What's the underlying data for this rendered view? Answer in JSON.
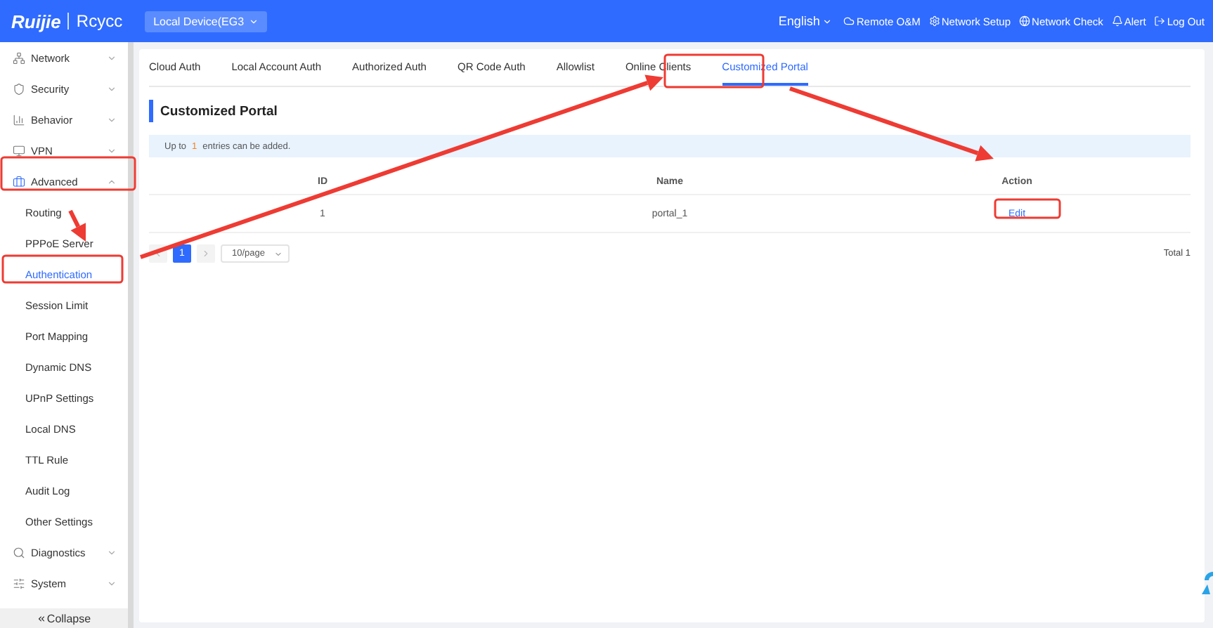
{
  "header": {
    "brand": "Ruijie",
    "product": "Rcycc",
    "device": "Local Device(EG3",
    "language": "English",
    "links": [
      {
        "kind": "cloud",
        "label": "Remote O&M"
      },
      {
        "kind": "setup",
        "label": "Network Setup"
      },
      {
        "kind": "check",
        "label": "Network Check"
      },
      {
        "kind": "alert",
        "label": "Alert"
      },
      {
        "kind": "logout",
        "label": "Log Out"
      }
    ]
  },
  "sidebar": {
    "items": [
      {
        "kind": "network",
        "label": "Network",
        "expanded": false
      },
      {
        "kind": "security",
        "label": "Security",
        "expanded": false
      },
      {
        "kind": "behavior",
        "label": "Behavior",
        "expanded": false
      },
      {
        "kind": "vpn",
        "label": "VPN",
        "expanded": false
      },
      {
        "kind": "advanced",
        "label": "Advanced",
        "expanded": true,
        "children": [
          {
            "label": "Routing",
            "selected": false
          },
          {
            "label": "PPPoE Server",
            "selected": false
          },
          {
            "label": "Authentication",
            "selected": true
          },
          {
            "label": "Session Limit",
            "selected": false
          },
          {
            "label": "Port Mapping",
            "selected": false
          },
          {
            "label": "Dynamic DNS",
            "selected": false
          },
          {
            "label": "UPnP Settings",
            "selected": false
          },
          {
            "label": "Local DNS",
            "selected": false
          },
          {
            "label": "TTL Rule",
            "selected": false
          },
          {
            "label": "Audit Log",
            "selected": false
          },
          {
            "label": "Other Settings",
            "selected": false
          }
        ]
      },
      {
        "kind": "diagnostics",
        "label": "Diagnostics",
        "expanded": false
      },
      {
        "kind": "system",
        "label": "System",
        "expanded": false
      }
    ],
    "collapse": "Collapse"
  },
  "tabs": [
    {
      "label": "Cloud Auth",
      "selected": false
    },
    {
      "label": "Local Account Auth",
      "selected": false
    },
    {
      "label": "Authorized Auth",
      "selected": false
    },
    {
      "label": "QR Code Auth",
      "selected": false
    },
    {
      "label": "Allowlist",
      "selected": false
    },
    {
      "label": "Online Clients",
      "selected": false
    },
    {
      "label": "Customized Portal",
      "selected": true
    }
  ],
  "section_title": "Customized Portal",
  "notice": {
    "prefix": "Up to",
    "count": "1",
    "suffix": "entries can be added."
  },
  "table": {
    "columns": [
      "ID",
      "Name",
      "Action"
    ],
    "rows": [
      {
        "id": "1",
        "name": "portal_1",
        "action": "Edit"
      }
    ]
  },
  "pagination": {
    "pages": [
      {
        "label": "1",
        "selected": true
      }
    ],
    "page_size": "10/page",
    "total": "Total 1"
  }
}
